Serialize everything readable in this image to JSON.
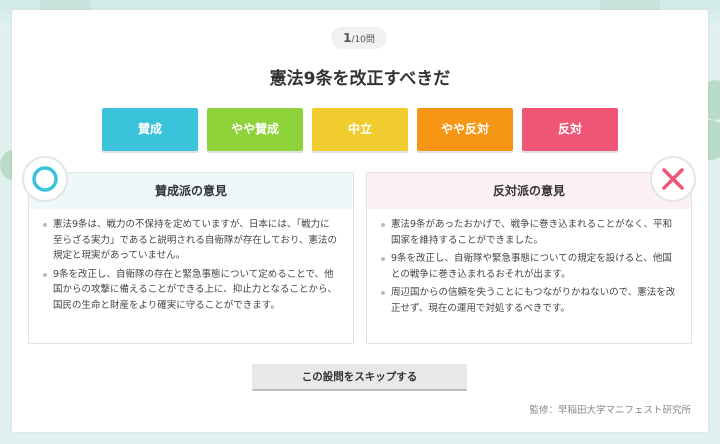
{
  "progress": {
    "current": "1",
    "total": "/10問"
  },
  "question": "憲法9条を改正すべきだ",
  "answers": [
    {
      "label": "賛成",
      "color": "#3cc3dc"
    },
    {
      "label": "やや賛成",
      "color": "#8fd33a"
    },
    {
      "label": "中立",
      "color": "#f1cc2e"
    },
    {
      "label": "やや反対",
      "color": "#f79514"
    },
    {
      "label": "反対",
      "color": "#ef5676"
    }
  ],
  "pro": {
    "title": "賛成派の意見",
    "head_color": "#eef8fb",
    "icon": "circle-icon",
    "points": [
      "憲法9条は、戦力の不保持を定めていますが、日本には、「戦力に至らざる実力」であると説明される自衛隊が存在しており、憲法の規定と現実があっていません。",
      "9条を改正し、自衛隊の存在と緊急事態について定めることで、他国からの攻撃に備えることができる上に、抑止力となることから、国民の生命と財産をより確実に守ることができます。"
    ]
  },
  "con": {
    "title": "反対派の意見",
    "head_color": "#fdf0f2",
    "icon": "cross-icon",
    "points": [
      "憲法9条があったおかげで、戦争に巻き込まれることがなく、平和国家を維持することができました。",
      "9条を改正し、自衛隊や緊急事態についての規定を設けると、他国との戦争に巻き込まれるおそれが出ます。",
      "周辺国からの信頼を失うことにもつながりかねないので、憲法を改正せず、現在の運用で対処するべきです。"
    ]
  },
  "skip_label": "この設問をスキップする",
  "credit": "監修：早稲田大学マニフェスト研究所"
}
